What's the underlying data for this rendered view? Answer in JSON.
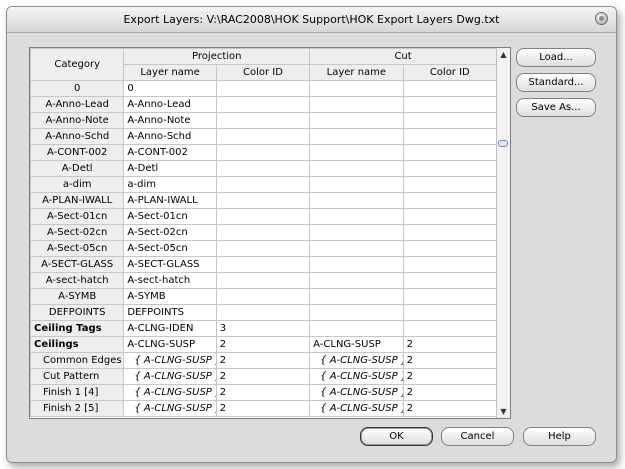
{
  "window": {
    "title": "Export Layers: V:\\RAC2008\\HOK Support\\HOK Export Layers Dwg.txt"
  },
  "grid": {
    "headers": {
      "category": "Category",
      "projection": "Projection",
      "cut": "Cut",
      "layer_name": "Layer name",
      "color_id": "Color ID"
    },
    "rows": [
      {
        "cat": "0",
        "p_layer": "0",
        "p_color": "",
        "c_layer": "",
        "c_color": "",
        "type": "normal"
      },
      {
        "cat": "A-Anno-Lead",
        "p_layer": "A-Anno-Lead",
        "p_color": "",
        "c_layer": "",
        "c_color": "",
        "type": "normal"
      },
      {
        "cat": "A-Anno-Note",
        "p_layer": "A-Anno-Note",
        "p_color": "",
        "c_layer": "",
        "c_color": "",
        "type": "normal"
      },
      {
        "cat": "A-Anno-Schd",
        "p_layer": "A-Anno-Schd",
        "p_color": "",
        "c_layer": "",
        "c_color": "",
        "type": "normal"
      },
      {
        "cat": "A-CONT-002",
        "p_layer": "A-CONT-002",
        "p_color": "",
        "c_layer": "",
        "c_color": "",
        "type": "normal"
      },
      {
        "cat": "A-Detl",
        "p_layer": "A-Detl",
        "p_color": "",
        "c_layer": "",
        "c_color": "",
        "type": "normal"
      },
      {
        "cat": "a-dim",
        "p_layer": "a-dim",
        "p_color": "",
        "c_layer": "",
        "c_color": "",
        "type": "normal"
      },
      {
        "cat": "A-PLAN-IWALL",
        "p_layer": "A-PLAN-IWALL",
        "p_color": "",
        "c_layer": "",
        "c_color": "",
        "type": "normal"
      },
      {
        "cat": "A-Sect-01cn",
        "p_layer": "A-Sect-01cn",
        "p_color": "",
        "c_layer": "",
        "c_color": "",
        "type": "normal"
      },
      {
        "cat": "A-Sect-02cn",
        "p_layer": "A-Sect-02cn",
        "p_color": "",
        "c_layer": "",
        "c_color": "",
        "type": "normal"
      },
      {
        "cat": "A-Sect-05cn",
        "p_layer": "A-Sect-05cn",
        "p_color": "",
        "c_layer": "",
        "c_color": "",
        "type": "normal"
      },
      {
        "cat": "A-SECT-GLASS",
        "p_layer": "A-SECT-GLASS",
        "p_color": "",
        "c_layer": "",
        "c_color": "",
        "type": "normal"
      },
      {
        "cat": "A-sect-hatch",
        "p_layer": "A-sect-hatch",
        "p_color": "",
        "c_layer": "",
        "c_color": "",
        "type": "normal"
      },
      {
        "cat": "A-SYMB",
        "p_layer": "A-SYMB",
        "p_color": "",
        "c_layer": "",
        "c_color": "",
        "type": "normal"
      },
      {
        "cat": "DEFPOINTS",
        "p_layer": "DEFPOINTS",
        "p_color": "",
        "c_layer": "",
        "c_color": "",
        "type": "normal"
      },
      {
        "cat": "Ceiling Tags",
        "p_layer": "A-CLNG-IDEN",
        "p_color": "3",
        "c_layer": "",
        "c_color": "",
        "type": "group"
      },
      {
        "cat": "Ceilings",
        "p_layer": "A-CLNG-SUSP",
        "p_color": "2",
        "c_layer": "A-CLNG-SUSP",
        "c_color": "2",
        "type": "group"
      },
      {
        "cat": "Common Edges",
        "p_layer": "{ A-CLNG-SUSP }",
        "p_color": "2",
        "c_layer": "{ A-CLNG-SUSP }",
        "c_color": "2",
        "type": "sub"
      },
      {
        "cat": "Cut Pattern",
        "p_layer": "{ A-CLNG-SUSP }",
        "p_color": "2",
        "c_layer": "{ A-CLNG-SUSP }",
        "c_color": "2",
        "type": "sub"
      },
      {
        "cat": "Finish 1 [4]",
        "p_layer": "{ A-CLNG-SUSP }",
        "p_color": "2",
        "c_layer": "{ A-CLNG-SUSP }",
        "c_color": "2",
        "type": "sub"
      },
      {
        "cat": "Finish 2 [5]",
        "p_layer": "{ A-CLNG-SUSP }",
        "p_color": "2",
        "c_layer": "{ A-CLNG-SUSP }",
        "c_color": "2",
        "type": "sub"
      }
    ]
  },
  "buttons": {
    "load": "Load...",
    "standard": "Standard...",
    "save_as": "Save As...",
    "ok": "OK",
    "cancel": "Cancel",
    "help": "Help"
  }
}
